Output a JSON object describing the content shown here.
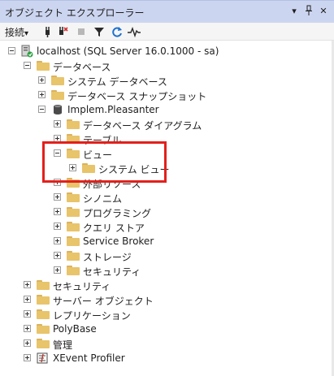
{
  "title_bar": {
    "title": "オブジェクト エクスプローラー",
    "dropdown_glyph": "▾",
    "pin_glyph": "ᛗ",
    "close_glyph": "✕"
  },
  "toolbar": {
    "connect_label": "接続",
    "connect_arrow": "▾"
  },
  "tree": {
    "server": "localhost (SQL Server 16.0.1000 - sa)",
    "databases": "データベース",
    "system_databases": "システム データベース",
    "database_snapshots": "データベース スナップショット",
    "db": "Implem.Pleasanter",
    "db_diagrams": "データベース ダイアグラム",
    "tables": "テーブル",
    "views": "ビュー",
    "system_views": "システム ビュー",
    "external_resources": "外部リソース",
    "synonyms": "シノニム",
    "programmability": "プログラミング",
    "query_store": "クエリ ストア",
    "service_broker": "Service Broker",
    "storage": "ストレージ",
    "db_security": "セキュリティ",
    "security": "セキュリティ",
    "server_objects": "サーバー オブジェクト",
    "replication": "レプリケーション",
    "polybase": "PolyBase",
    "management": "管理",
    "xevent_profiler": "XEvent Profiler"
  },
  "colors": {
    "titlebar": "#ccd5f0",
    "highlight": "#e3201c",
    "folder": "#e8c46a"
  }
}
